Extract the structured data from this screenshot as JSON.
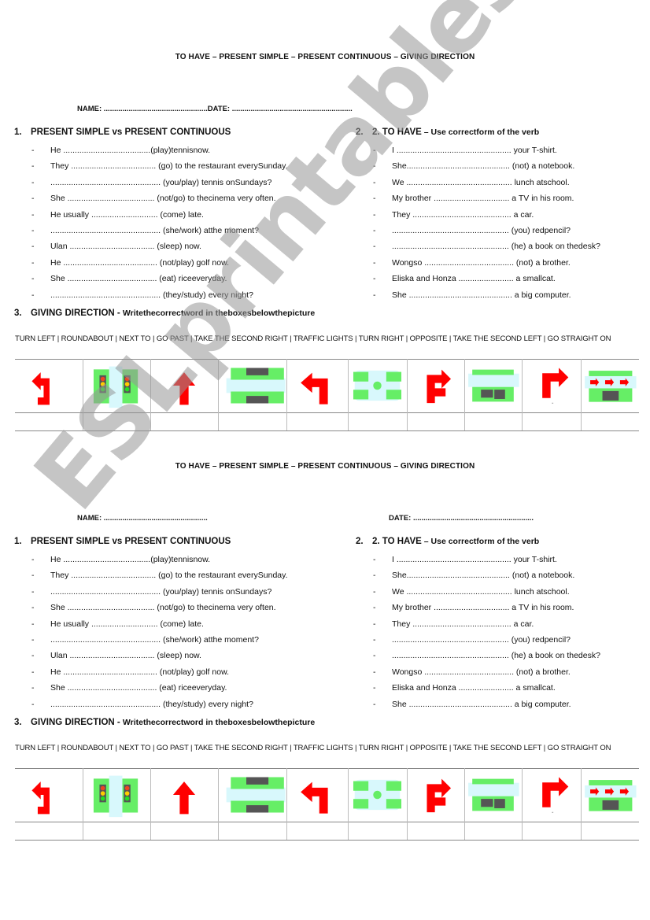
{
  "title": "TO HAVE – PRESENT SIMPLE – PRESENT CONTINUOUS – GIVING DIRECTION",
  "name_label": "NAME: ..................................................",
  "date_label": "DATE: ..........................................................",
  "name_label_2": "NAME: ..................................................",
  "date_label_2": "DATE: ..........................................................",
  "section1": {
    "number": "1.",
    "heading": "PRESENT SIMPLE vs PRESENT CONTINUOUS",
    "items": [
      "He ......................................(play)tennisnow.",
      "They ..................................... (go) to the restaurant everySunday.",
      "................................................ (you/play) tennis onSundays?",
      "She ...................................... (not/go) to thecinema very often.",
      "He usually ............................. (come) late.",
      "................................................ (she/work) atthe moment?",
      "Ulan ..................................... (sleep) now.",
      "He ......................................... (not/play) golf now.",
      "She ....................................... (eat) riceeveryday.",
      "................................................ (they/study) every night?"
    ]
  },
  "section2": {
    "number": "2.",
    "heading": "2. TO HAVE",
    "subheading": " – Use correctform of the verb",
    "items": [
      "I .................................................. your T-shirt.",
      "She............................................. (not) a notebook.",
      "We .............................................. lunch atschool.",
      "My brother ................................. a TV in his room.",
      "They ........................................... a car.",
      "................................................... (you) redpencil?",
      "................................................... (he) a book on thedesk?",
      "Wongso ....................................... (not) a brother.",
      "Eliska and Honza ........................ a smallcat.",
      "She ............................................. a big computer."
    ]
  },
  "section3": {
    "number": "3.",
    "heading": "GIVING DIRECTION - ",
    "subheading": "Writethecorrectword in theboxesbelowthepicture",
    "word_bank": "TURN LEFT | ROUNDABOUT | NEXT TO | GO PAST | TAKE THE SECOND RIGHT | TRAFFIC LIGHTS | TURN RIGHT | OPPOSITE | TAKE THE SECOND LEFT | GO STRAIGHT ON",
    "pictures": [
      "take-second-left-arrow-icon",
      "traffic-lights-icon",
      "go-straight-on-arrow-icon",
      "opposite-icon",
      "turn-left-arrow-icon",
      "roundabout-icon",
      "take-second-right-arrow-icon",
      "next-to-icon",
      "turn-right-arrow-icon",
      "go-past-icon"
    ]
  },
  "colors": {
    "arrow_red": "#ff0000",
    "grass_green": "#66ee66",
    "road_blue": "#d8f8fc",
    "building_gray": "#555555"
  },
  "watermark": "ESLprintables.com"
}
